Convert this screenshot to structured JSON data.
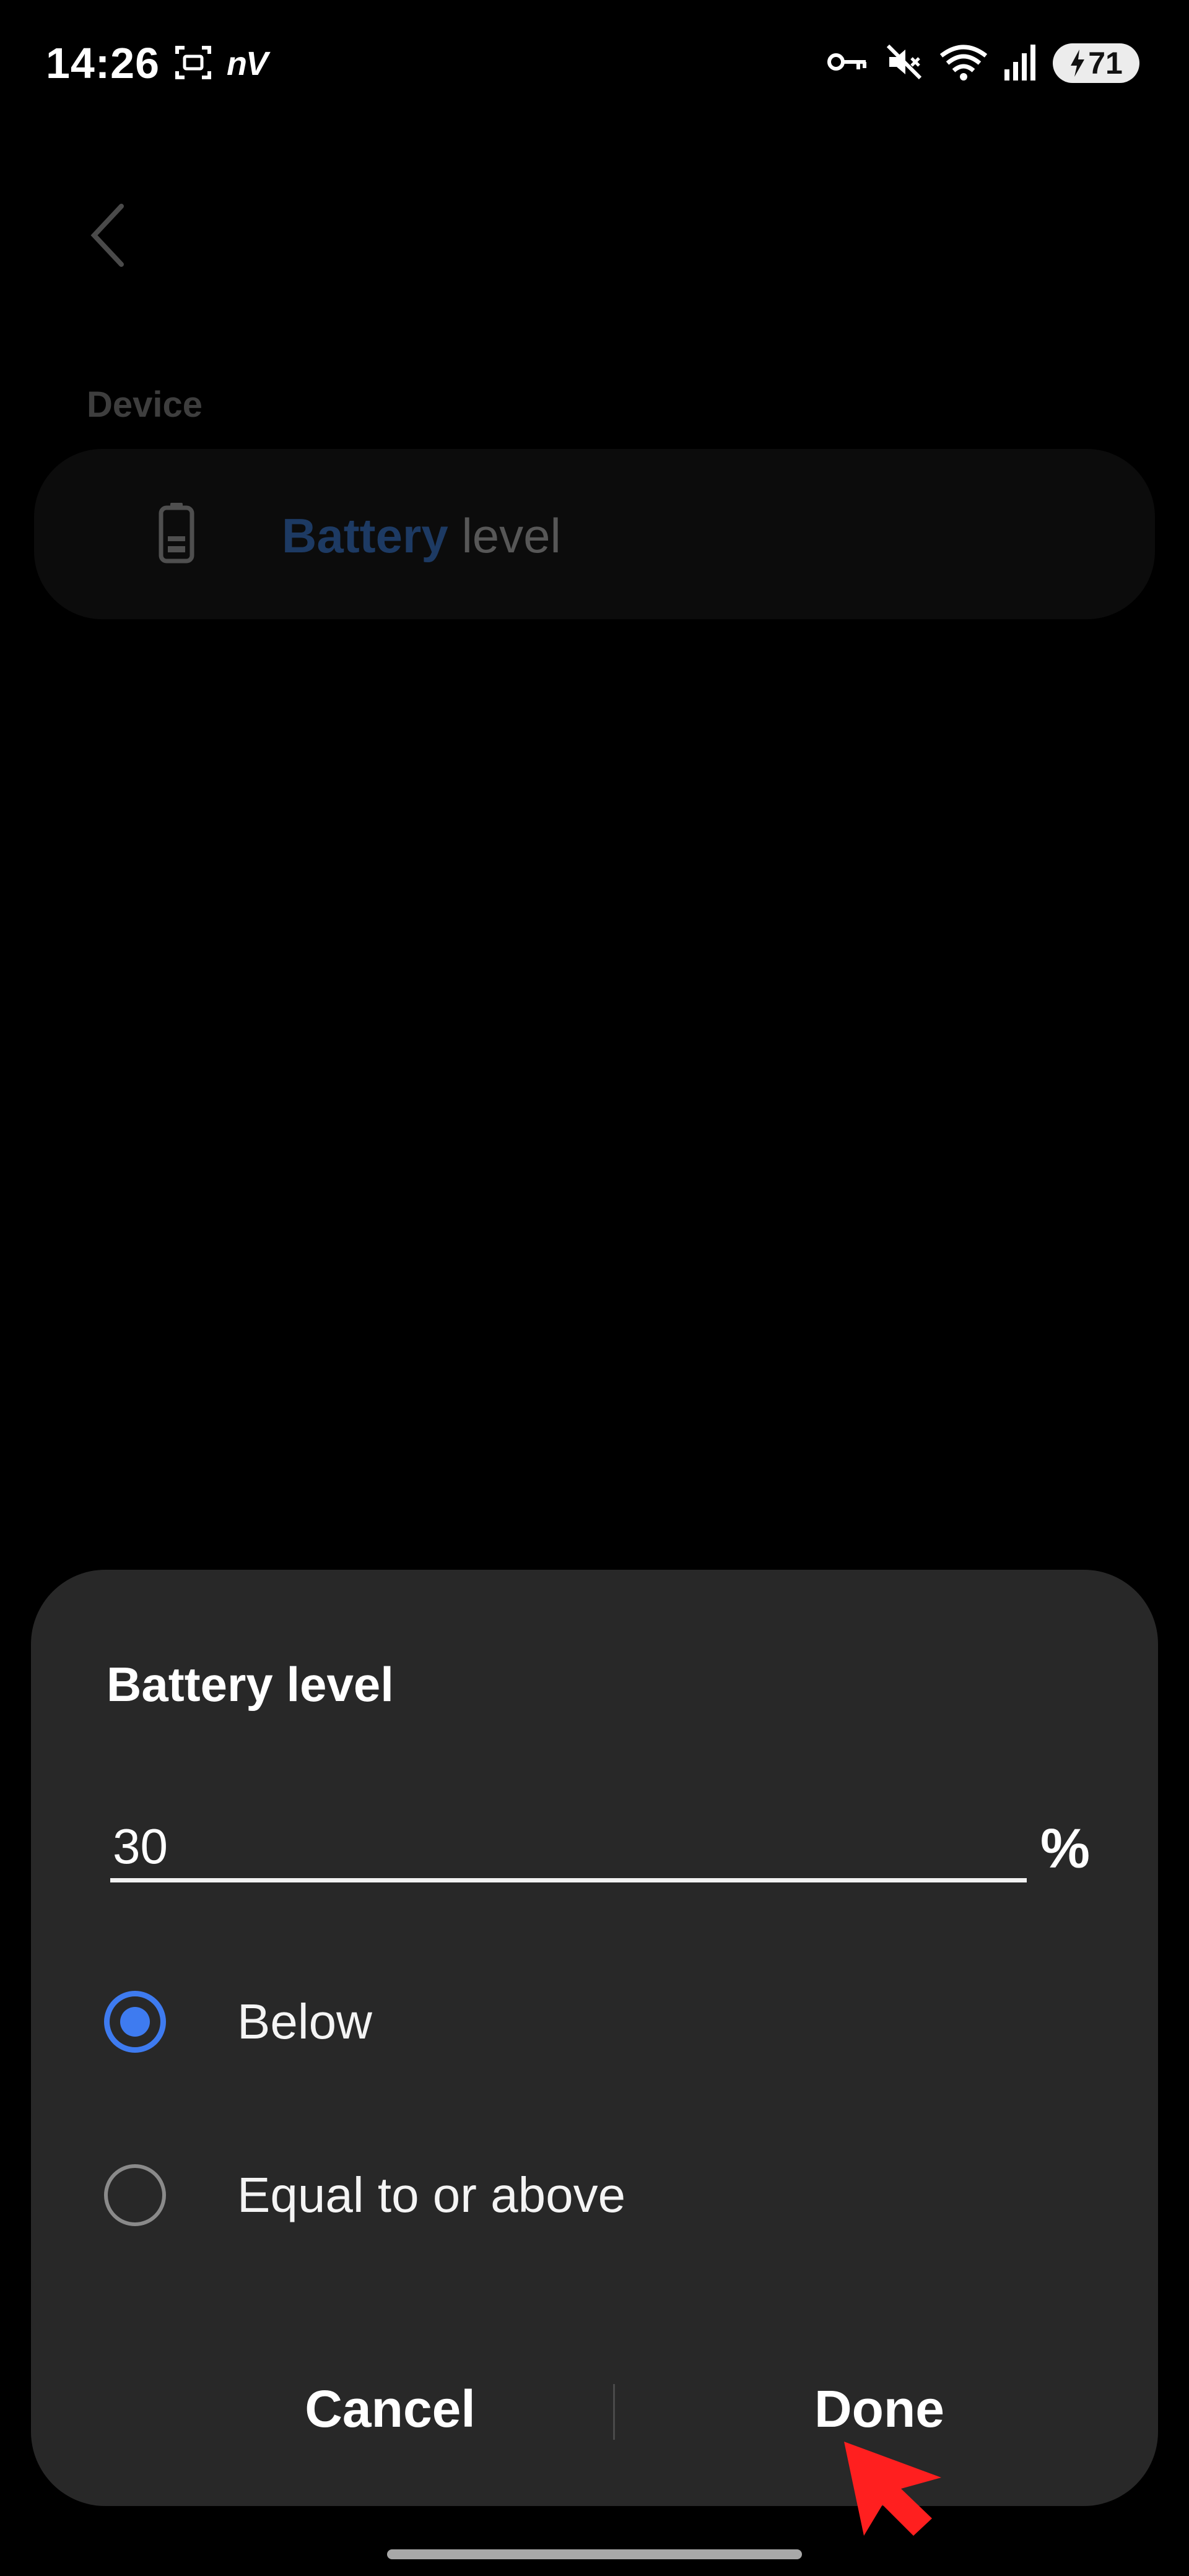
{
  "status_bar": {
    "time": "14:26",
    "network_label": "nV",
    "battery_level": "71"
  },
  "page": {
    "section_label": "Device",
    "card": {
      "highlight_text": "Battery",
      "rest_text": " level",
      "icon": "battery-icon"
    }
  },
  "dialog": {
    "title": "Battery level",
    "input_value": "30",
    "unit": "%",
    "options": [
      {
        "label": "Below",
        "selected": true
      },
      {
        "label": "Equal to or above",
        "selected": false
      }
    ],
    "cancel_label": "Cancel",
    "done_label": "Done"
  },
  "colors": {
    "accent": "#3e7bf0",
    "dialog_bg": "#282828",
    "highlight_text": "#1d3a63",
    "pointer": "#ff1f1f"
  }
}
